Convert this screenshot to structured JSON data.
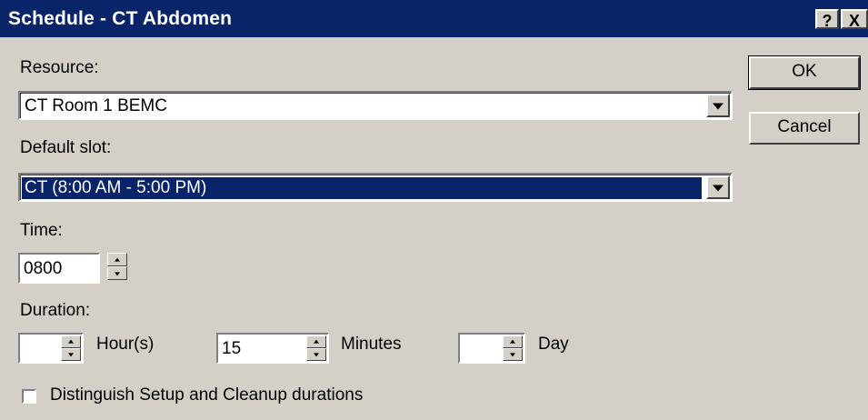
{
  "window": {
    "title": "Schedule - CT Abdomen",
    "help_glyph": "?",
    "close_glyph": "X"
  },
  "resource": {
    "label": "Resource:",
    "value": "CT Room 1 BEMC"
  },
  "default_slot": {
    "label": "Default slot:",
    "value": "CT (8:00 AM - 5:00 PM)"
  },
  "time": {
    "label": "Time:",
    "value": "0800"
  },
  "duration": {
    "label": "Duration:",
    "hours_value": "",
    "hours_label": "Hour(s)",
    "minutes_value": "15",
    "minutes_label": "Minutes",
    "day_value": "",
    "day_label": "Day"
  },
  "distinguish": {
    "label": "Distinguish Setup and Cleanup durations",
    "checked": false
  },
  "buttons": {
    "ok": "OK",
    "cancel": "Cancel"
  },
  "colors": {
    "title_bar": "#0a246a",
    "dialog_bg": "#d4d0c8",
    "selection": "#0a246a"
  }
}
